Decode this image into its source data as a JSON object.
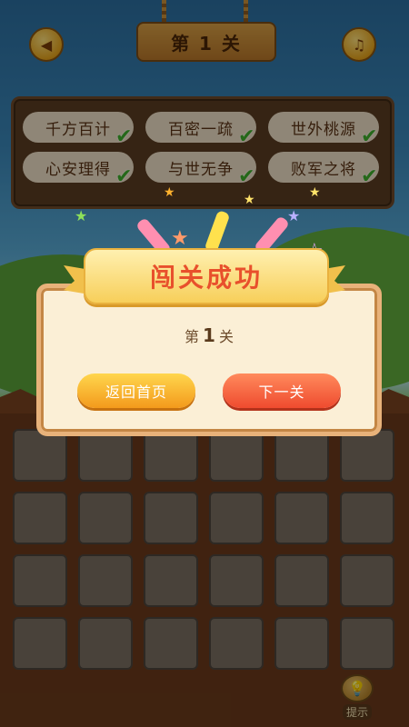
{
  "header": {
    "level_sign": "第 1 关",
    "back_icon": "back-arrow-icon",
    "music_icon": "music-note-icon"
  },
  "answers": [
    {
      "text": "千方百计",
      "solved": true
    },
    {
      "text": "百密一疏",
      "solved": true
    },
    {
      "text": "世外桃源",
      "solved": true
    },
    {
      "text": "心安理得",
      "solved": true
    },
    {
      "text": "与世无争",
      "solved": true
    },
    {
      "text": "败军之将",
      "solved": true
    }
  ],
  "dialog": {
    "banner": "闯关成功",
    "level_prefix": "第",
    "level_number": "1",
    "level_suffix": "关",
    "home_button": "返回首页",
    "next_button": "下一关"
  },
  "hint": {
    "label": "提示",
    "icon": "lightbulb-icon"
  },
  "colors": {
    "check": "#3fae2a",
    "banner_text": "#e8502c",
    "home_button": "#f5a623",
    "next_button": "#f05a35"
  }
}
